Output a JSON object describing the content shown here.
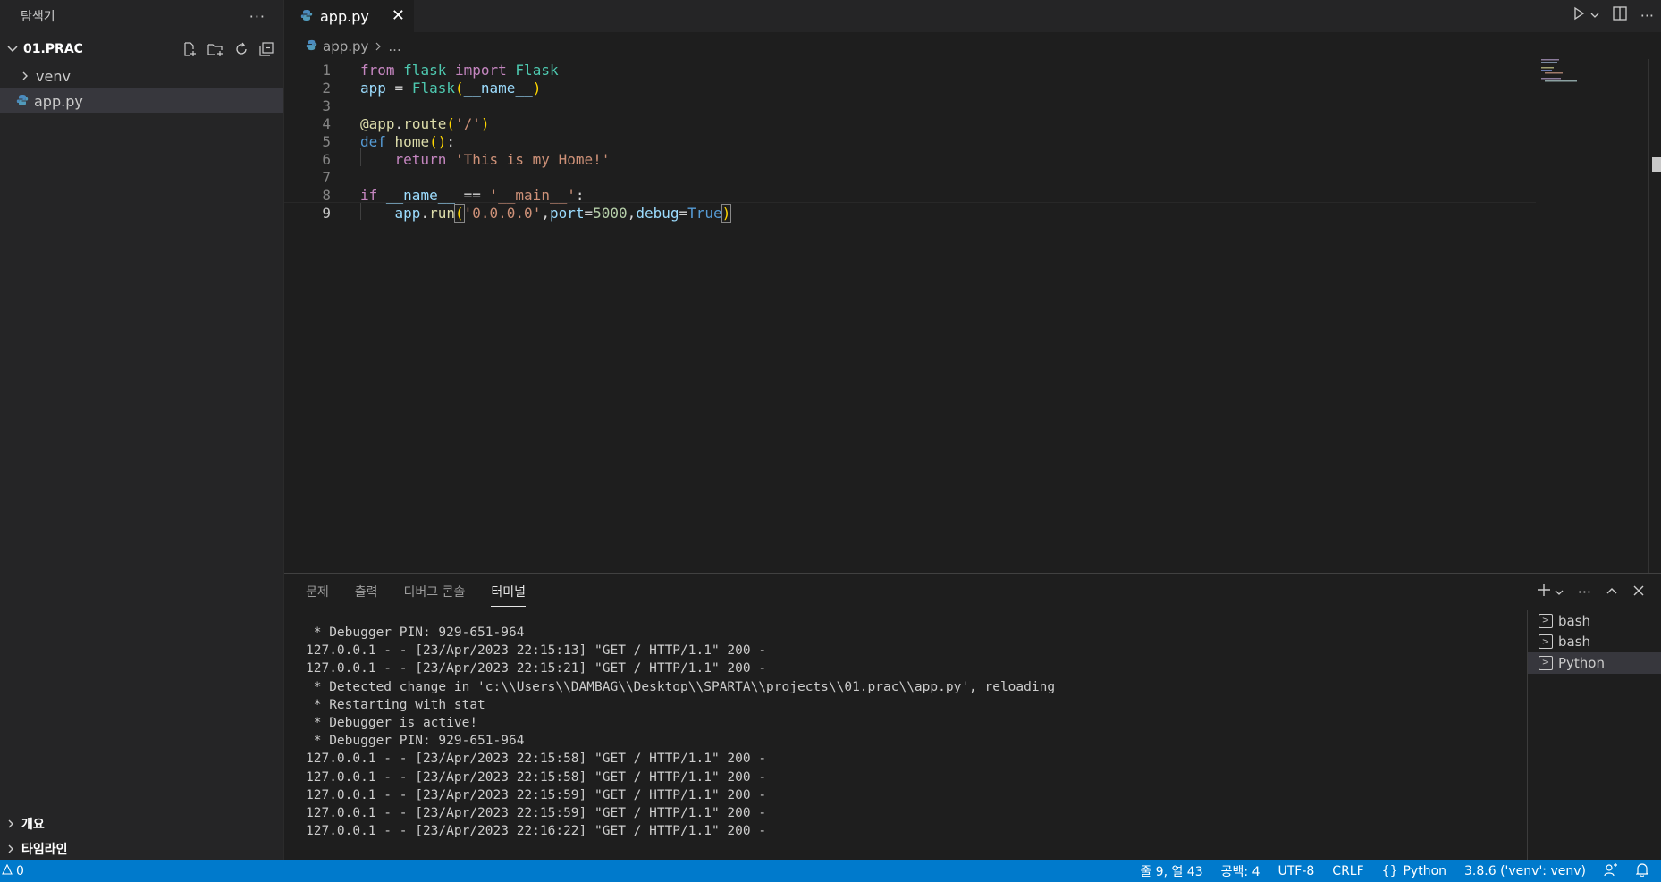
{
  "sidebar": {
    "title": "탐색기",
    "more": "···",
    "folder": "01.PRAC",
    "items": [
      {
        "label": "venv",
        "type": "folder"
      },
      {
        "label": "app.py",
        "type": "file"
      }
    ],
    "bottom_sections": [
      "개요",
      "타임라인"
    ]
  },
  "tabs": [
    {
      "label": "app.py",
      "close": "✕"
    }
  ],
  "breadcrumb": {
    "file": "app.py",
    "more": "..."
  },
  "editor": {
    "line_numbers": [
      "1",
      "2",
      "3",
      "4",
      "5",
      "6",
      "7",
      "8",
      "9"
    ],
    "current_line": 9
  },
  "panel": {
    "tabs": [
      "문제",
      "출력",
      "디버그 콘솔",
      "터미널"
    ],
    "active_tab": "터미널",
    "terminal_lines": [
      " * Debugger PIN: 929-651-964",
      "127.0.0.1 - - [23/Apr/2023 22:15:13] \"GET / HTTP/1.1\" 200 -",
      "127.0.0.1 - - [23/Apr/2023 22:15:21] \"GET / HTTP/1.1\" 200 -",
      " * Detected change in 'c:\\\\Users\\\\DAMBAG\\\\Desktop\\\\SPARTA\\\\projects\\\\01.prac\\\\app.py', reloading",
      " * Restarting with stat",
      " * Debugger is active!",
      " * Debugger PIN: 929-651-964",
      "127.0.0.1 - - [23/Apr/2023 22:15:58] \"GET / HTTP/1.1\" 200 -",
      "127.0.0.1 - - [23/Apr/2023 22:15:58] \"GET / HTTP/1.1\" 200 -",
      "127.0.0.1 - - [23/Apr/2023 22:15:59] \"GET / HTTP/1.1\" 200 -",
      "127.0.0.1 - - [23/Apr/2023 22:15:59] \"GET / HTTP/1.1\" 200 -",
      "127.0.0.1 - - [23/Apr/2023 22:16:22] \"GET / HTTP/1.1\" 200 -"
    ],
    "terminals": [
      {
        "label": "bash",
        "active": false
      },
      {
        "label": "bash",
        "active": false
      },
      {
        "label": "Python",
        "active": true
      }
    ]
  },
  "statusbar": {
    "problems": "0",
    "position": "줄 9, 열 43",
    "spaces": "공백: 4",
    "encoding": "UTF-8",
    "eol": "CRLF",
    "language": "Python",
    "interpreter": "3.8.6 ('venv': venv)"
  },
  "colors": {
    "statusbar": "#007acc",
    "sidebar": "#252526",
    "editor": "#1e1e1e"
  }
}
